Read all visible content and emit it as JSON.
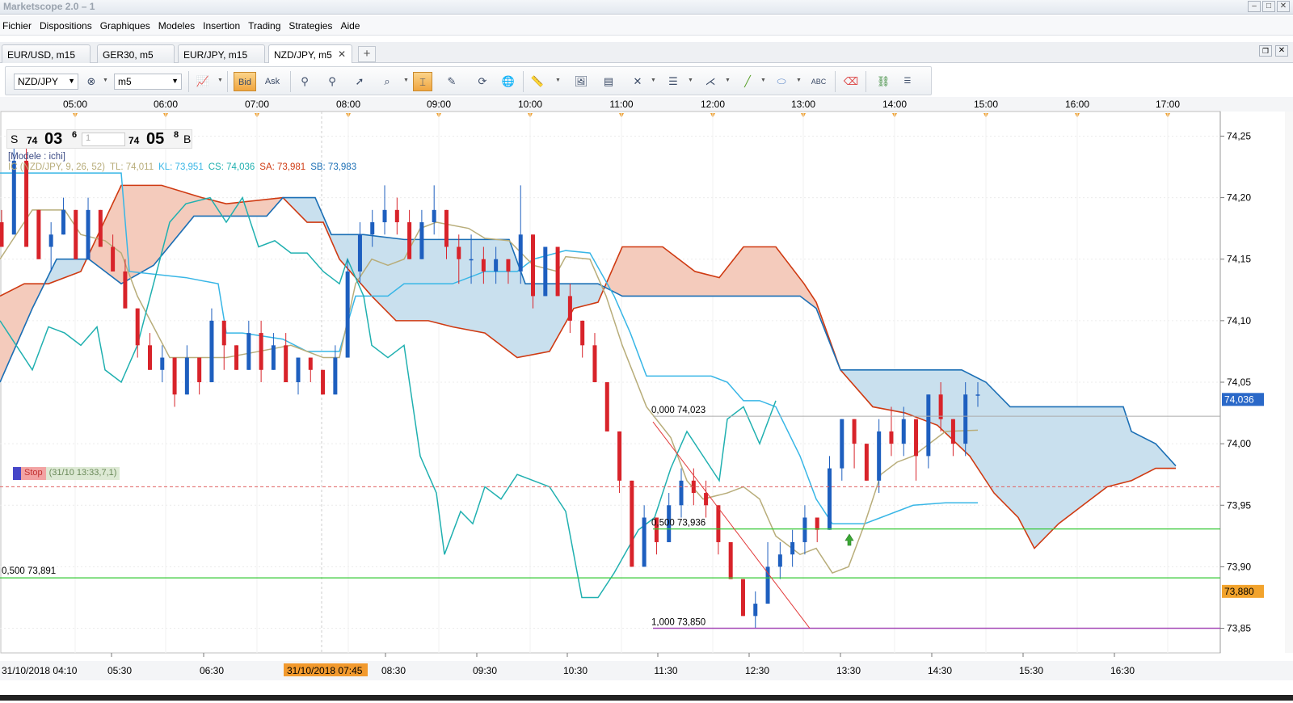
{
  "window": {
    "title": "Marketscope 2.0 – 1"
  },
  "menu": [
    "Fichier",
    "Dispositions",
    "Graphiques",
    "Modeles",
    "Insertion",
    "Trading",
    "Strategies",
    "Aide"
  ],
  "tabs": [
    {
      "label": "EUR/USD, m15"
    },
    {
      "label": "GER30, m5"
    },
    {
      "label": "EUR/JPY, m15"
    },
    {
      "label": "NZD/JPY, m5",
      "active": true,
      "close": "✕"
    }
  ],
  "toolbar": {
    "instrument": "NZD/JPY",
    "timeframe": "m5",
    "bid_label": "Bid",
    "ask_label": "Ask"
  },
  "price": {
    "sell_label": "S",
    "sell_big": "74",
    "sell_main": "03",
    "sell_sup": "6",
    "lot_placeholder": "1",
    "buy_big": "74",
    "buy_main": "05",
    "buy_sup": "8",
    "buy_label": "B"
  },
  "legend": {
    "model": "[Modele : ichi]",
    "indicator": "IC (NZD/JPY, 9, 26, 52)",
    "tl": "TL: 74,011",
    "kl": "KL: 73,951",
    "cs": "CS: 74,036",
    "sa": "SA: 73,981",
    "sb": "SB: 73,983"
  },
  "stop": {
    "label": "Stop",
    "detail": "(31/10 13:33,7,1)"
  },
  "fib": {
    "level0": "0,000 74,023",
    "level50": "0,500 73,936",
    "level100": "1,000 73,850",
    "left_level": "0,500 73,891"
  },
  "axis": {
    "top_times": [
      "05:00",
      "06:00",
      "07:00",
      "08:00",
      "09:00",
      "10:00",
      "11:00",
      "12:00",
      "13:00",
      "14:00",
      "15:00",
      "16:00",
      "17:00"
    ],
    "bottom_times": [
      "31/10/2018 04:10",
      "05:30",
      "06:30",
      "31/10/2018 07:45",
      "08:30",
      "09:30",
      "10:30",
      "11:30",
      "12:30",
      "13:30",
      "14:30",
      "15:30",
      "16:30"
    ],
    "prices": [
      "74,25",
      "74,20",
      "74,15",
      "74,10",
      "74,05",
      "74,00",
      "73,95",
      "73,90",
      "73,85"
    ],
    "current_price": "74,036",
    "level_tag": "73,880"
  },
  "colors": {
    "bull": "#1e5fbf",
    "bear": "#d8232a",
    "tenkan": "#b8ad7a",
    "kijun": "#38b6e6",
    "chikou": "#20b0b0",
    "senkou_a": "#cf3a12",
    "senkou_b": "#1b6fb5",
    "cloud_bull": "#c9e0ee",
    "cloud_bear": "#f4cbbc",
    "fib_green": "#34c834",
    "fib_purple": "#a64bb8",
    "trend_line": "#e23a3a"
  },
  "chart_data": {
    "type": "candlestick",
    "instrument": "NZD/JPY",
    "timeframe": "m5",
    "ylim": [
      73.83,
      74.27
    ],
    "current_price": 74.036,
    "fib_levels": [
      {
        "ratio": 0.0,
        "price": 74.023
      },
      {
        "ratio": 0.5,
        "price": 73.936
      },
      {
        "ratio": 1.0,
        "price": 73.85
      }
    ],
    "other_levels": [
      73.891,
      73.965
    ],
    "candles": [
      [
        74.18,
        74.16,
        74.19,
        74.16
      ],
      [
        74.17,
        74.23,
        74.24,
        74.17
      ],
      [
        74.23,
        74.16,
        74.25,
        74.16
      ],
      [
        74.19,
        74.15,
        74.19,
        74.15
      ],
      [
        74.16,
        74.17,
        74.18,
        74.14
      ],
      [
        74.17,
        74.19,
        74.2,
        74.17
      ],
      [
        74.19,
        74.15,
        74.19,
        74.15
      ],
      [
        74.15,
        74.19,
        74.2,
        74.15
      ],
      [
        74.19,
        74.16,
        74.19,
        74.16
      ],
      [
        74.16,
        74.14,
        74.17,
        74.14
      ],
      [
        74.14,
        74.11,
        74.15,
        74.11
      ],
      [
        74.11,
        74.08,
        74.11,
        74.07
      ],
      [
        74.08,
        74.06,
        74.09,
        74.06
      ],
      [
        74.06,
        74.07,
        74.08,
        74.05
      ],
      [
        74.07,
        74.04,
        74.07,
        74.03
      ],
      [
        74.04,
        74.07,
        74.08,
        74.04
      ],
      [
        74.07,
        74.05,
        74.07,
        74.04
      ],
      [
        74.05,
        74.1,
        74.11,
        74.05
      ],
      [
        74.1,
        74.08,
        74.1,
        74.06
      ],
      [
        74.08,
        74.06,
        74.08,
        74.06
      ],
      [
        74.06,
        74.09,
        74.1,
        74.06
      ],
      [
        74.09,
        74.06,
        74.1,
        74.05
      ],
      [
        74.06,
        74.08,
        74.09,
        74.06
      ],
      [
        74.08,
        74.05,
        74.09,
        74.05
      ],
      [
        74.05,
        74.07,
        74.07,
        74.04
      ],
      [
        74.07,
        74.06,
        74.07,
        74.05
      ],
      [
        74.06,
        74.04,
        74.06,
        74.04
      ],
      [
        74.04,
        74.07,
        74.08,
        74.04
      ],
      [
        74.07,
        74.14,
        74.15,
        74.07
      ],
      [
        74.14,
        74.17,
        74.18,
        74.13
      ],
      [
        74.17,
        74.18,
        74.19,
        74.16
      ],
      [
        74.18,
        74.19,
        74.21,
        74.17
      ],
      [
        74.19,
        74.18,
        74.2,
        74.17
      ],
      [
        74.18,
        74.15,
        74.19,
        74.15
      ],
      [
        74.15,
        74.18,
        74.19,
        74.15
      ],
      [
        74.18,
        74.19,
        74.21,
        74.17
      ],
      [
        74.19,
        74.16,
        74.19,
        74.15
      ],
      [
        74.16,
        74.15,
        74.17,
        74.13
      ],
      [
        74.15,
        74.15,
        74.17,
        74.13
      ],
      [
        74.15,
        74.14,
        74.16,
        74.13
      ],
      [
        74.14,
        74.15,
        74.16,
        74.13
      ],
      [
        74.15,
        74.14,
        74.15,
        74.13
      ],
      [
        74.14,
        74.17,
        74.21,
        74.13
      ],
      [
        74.17,
        74.12,
        74.17,
        74.11
      ],
      [
        74.12,
        74.16,
        74.16,
        74.12
      ],
      [
        74.16,
        74.12,
        74.16,
        74.12
      ],
      [
        74.12,
        74.1,
        74.13,
        74.09
      ],
      [
        74.1,
        74.08,
        74.1,
        74.07
      ],
      [
        74.08,
        74.05,
        74.09,
        74.05
      ],
      [
        74.05,
        74.01,
        74.05,
        74.01
      ],
      [
        74.01,
        73.97,
        74.01,
        73.96
      ],
      [
        73.97,
        73.9,
        73.97,
        73.9
      ],
      [
        73.9,
        73.94,
        73.95,
        73.9
      ],
      [
        73.94,
        73.92,
        73.94,
        73.91
      ],
      [
        73.92,
        73.95,
        73.96,
        73.92
      ],
      [
        73.95,
        73.97,
        73.98,
        73.94
      ],
      [
        73.97,
        73.96,
        73.98,
        73.95
      ],
      [
        73.96,
        73.95,
        73.97,
        73.94
      ],
      [
        73.95,
        73.92,
        73.95,
        73.91
      ],
      [
        73.92,
        73.89,
        73.92,
        73.89
      ],
      [
        73.89,
        73.86,
        73.89,
        73.86
      ],
      [
        73.86,
        73.87,
        73.88,
        73.85
      ],
      [
        73.87,
        73.9,
        73.92,
        73.87
      ],
      [
        73.9,
        73.91,
        73.92,
        73.89
      ],
      [
        73.91,
        73.92,
        73.93,
        73.9
      ],
      [
        73.92,
        73.94,
        73.95,
        73.91
      ],
      [
        73.94,
        73.93,
        73.94,
        73.92
      ],
      [
        73.93,
        73.98,
        73.99,
        73.93
      ],
      [
        73.98,
        74.02,
        74.02,
        73.97
      ],
      [
        74.02,
        74.0,
        74.02,
        73.98
      ],
      [
        74.0,
        73.97,
        74.0,
        73.97
      ],
      [
        73.97,
        74.01,
        74.02,
        73.96
      ],
      [
        74.01,
        74.0,
        74.03,
        73.99
      ],
      [
        74.0,
        74.02,
        74.03,
        73.99
      ],
      [
        74.02,
        73.99,
        74.02,
        73.97
      ],
      [
        73.99,
        74.04,
        74.04,
        73.98
      ],
      [
        74.04,
        74.02,
        74.05,
        74.01
      ],
      [
        74.02,
        74.0,
        74.02,
        73.99
      ],
      [
        74.0,
        74.04,
        74.05,
        73.99
      ],
      [
        74.04,
        74.04,
        74.05,
        74.03
      ]
    ]
  }
}
